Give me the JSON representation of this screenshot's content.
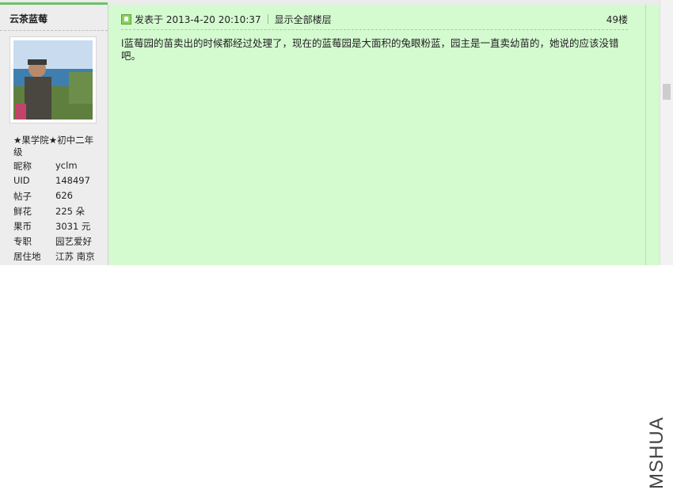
{
  "user": {
    "name": "云茶蓝莓",
    "title": "★果学院★初中二年级",
    "fields": [
      {
        "label": "昵称",
        "value": "yclm"
      },
      {
        "label": "UID",
        "value": "148497"
      },
      {
        "label": "帖子",
        "value": "626"
      },
      {
        "label": "鲜花",
        "value": "225 朵"
      },
      {
        "label": "果币",
        "value": "3031 元"
      },
      {
        "label": "专职",
        "value": "园艺爱好"
      },
      {
        "label": "居住地",
        "value": "江苏 南京"
      }
    ]
  },
  "post": {
    "meta": "发表于 2013-4-20 20:10:37",
    "show_all": "显示全部楼层",
    "floor": "49楼",
    "body": "l蓝莓园的苗卖出的时候都经过处理了，现在的蓝莓园是大面积的兔眼粉蓝，园主是一直卖幼苗的，她说的应该没错吧。"
  },
  "watermark": "MSHUA"
}
